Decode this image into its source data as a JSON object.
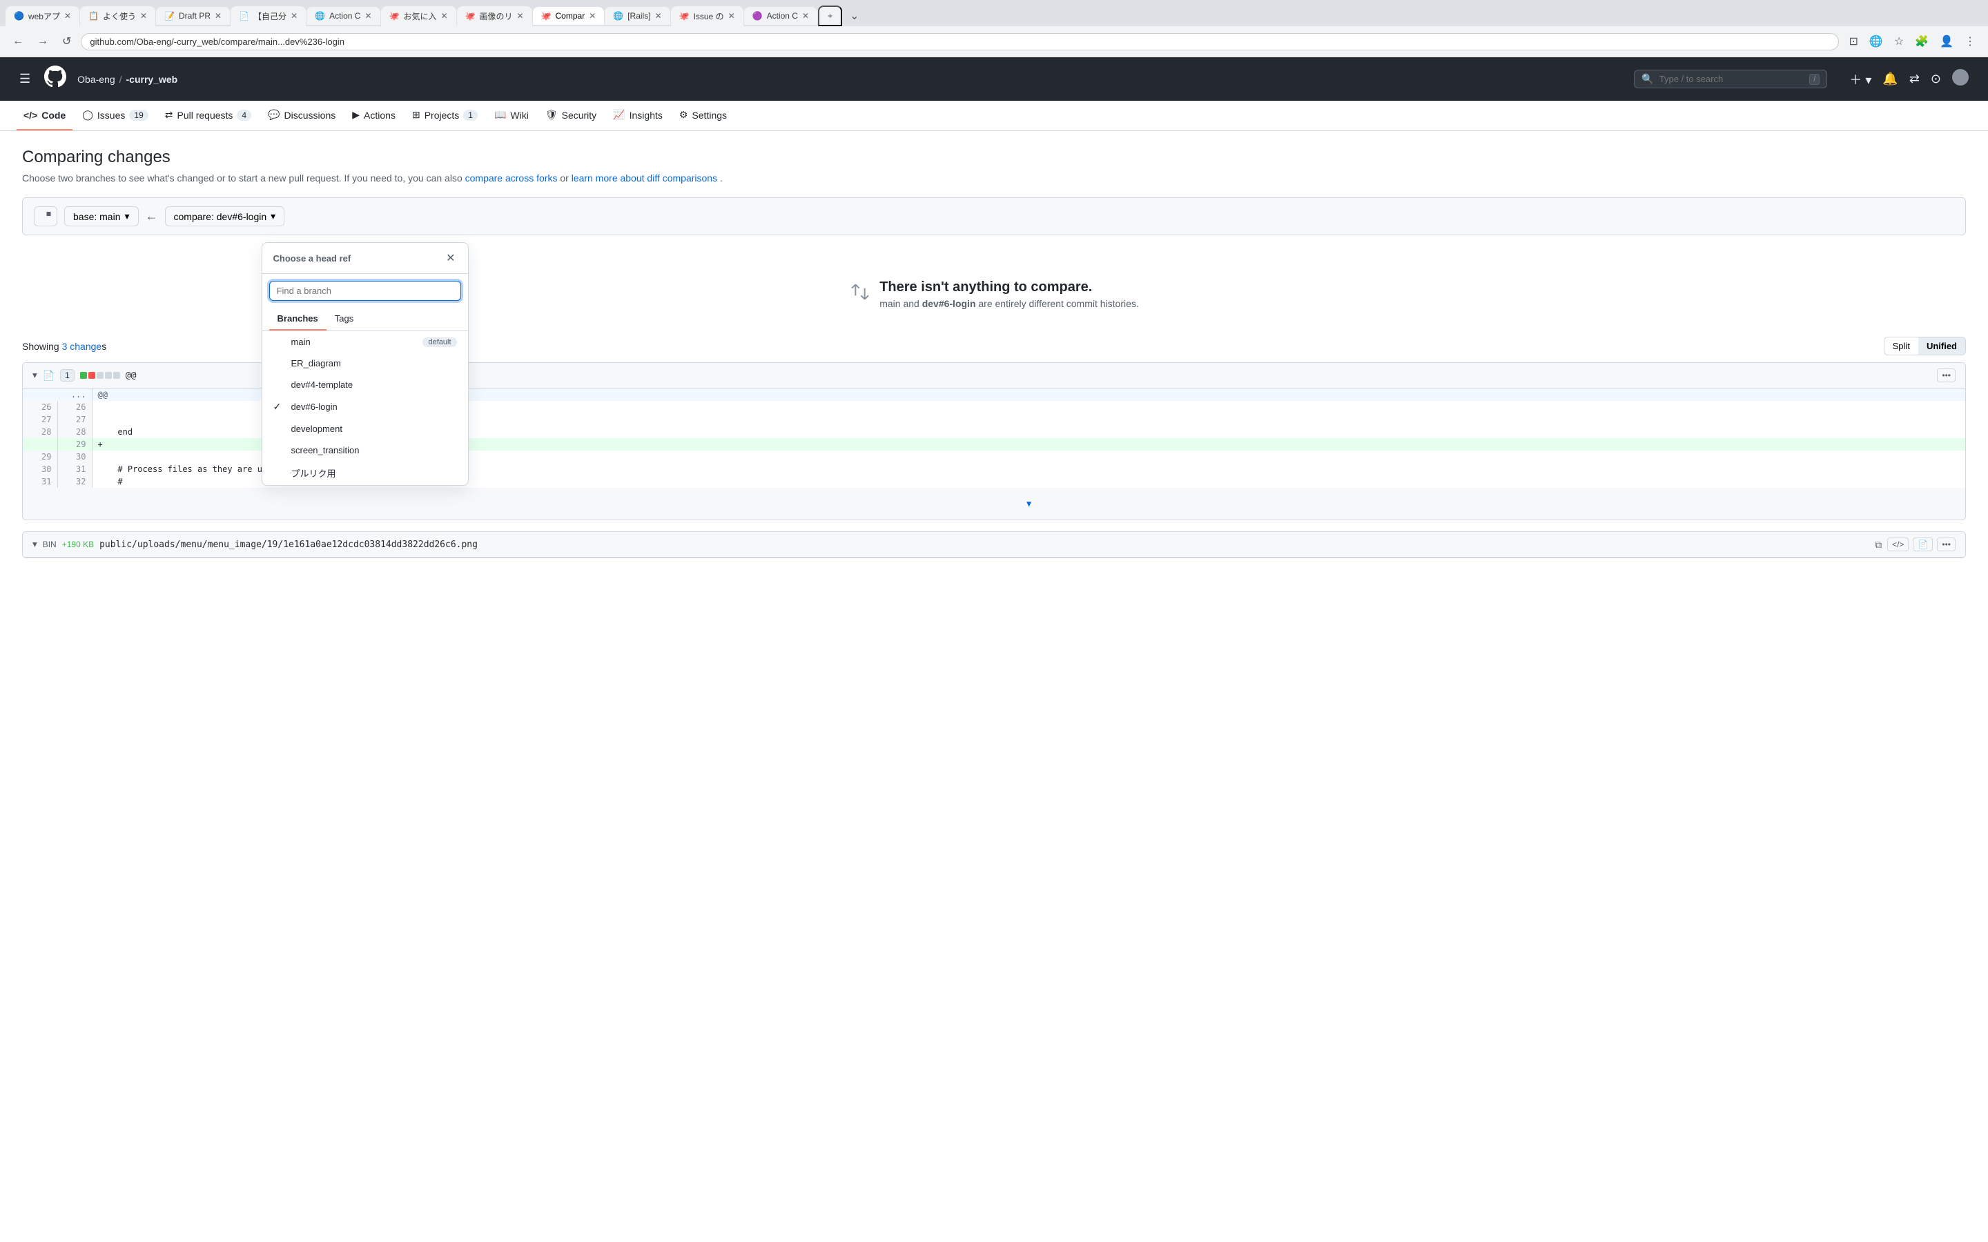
{
  "browser": {
    "url": "github.com/Oba-eng/-curry_web/compare/main...dev%236-login",
    "tabs": [
      {
        "id": "tab1",
        "label": "webアプ",
        "icon": "🔵",
        "active": false
      },
      {
        "id": "tab2",
        "label": "よく使う",
        "icon": "📋",
        "active": false
      },
      {
        "id": "tab3",
        "label": "Draft PR",
        "icon": "📝",
        "active": false
      },
      {
        "id": "tab4",
        "label": "【自己分",
        "icon": "📄",
        "active": false
      },
      {
        "id": "tab5",
        "label": "Action C",
        "icon": "🌐",
        "active": false
      },
      {
        "id": "tab6",
        "label": "お気に入",
        "icon": "🐙",
        "active": false
      },
      {
        "id": "tab7",
        "label": "画像のリ",
        "icon": "🐙",
        "active": false
      },
      {
        "id": "tab8",
        "label": "Compar",
        "icon": "🐙",
        "active": true
      },
      {
        "id": "tab9",
        "label": "[Rails]",
        "icon": "🌐",
        "active": false
      },
      {
        "id": "tab10",
        "label": "Issue の",
        "icon": "🐙",
        "active": false
      },
      {
        "id": "tab11",
        "label": "Action C",
        "icon": "🟣",
        "active": false
      }
    ]
  },
  "github_header": {
    "logo_alt": "GitHub",
    "org": "Oba-eng",
    "separator": "/",
    "repo": "-curry_web",
    "search_placeholder": "Type / to search",
    "search_slash_badge": "/"
  },
  "repo_nav": {
    "items": [
      {
        "id": "code",
        "label": "Code",
        "icon": "code",
        "badge": null,
        "active": true
      },
      {
        "id": "issues",
        "label": "Issues",
        "icon": "circle",
        "badge": "19",
        "active": false
      },
      {
        "id": "pull_requests",
        "label": "Pull requests",
        "icon": "pull",
        "badge": "4",
        "active": false
      },
      {
        "id": "discussions",
        "label": "Discussions",
        "icon": "chat",
        "badge": null,
        "active": false
      },
      {
        "id": "actions",
        "label": "Actions",
        "icon": "play",
        "badge": null,
        "active": false
      },
      {
        "id": "projects",
        "label": "Projects",
        "icon": "grid",
        "badge": "1",
        "active": false
      },
      {
        "id": "wiki",
        "label": "Wiki",
        "icon": "book",
        "badge": null,
        "active": false
      },
      {
        "id": "security",
        "label": "Security",
        "icon": "shield",
        "badge": null,
        "active": false
      },
      {
        "id": "insights",
        "label": "Insights",
        "icon": "graph",
        "badge": null,
        "active": false
      },
      {
        "id": "settings",
        "label": "Settings",
        "icon": "gear",
        "badge": null,
        "active": false
      }
    ]
  },
  "page": {
    "title": "Comparing changes",
    "description_start": "Choose two branches to see what's changed or to start a new pull request. If you need to, you can also ",
    "link1_text": "compare across forks",
    "link1_url": "#",
    "link_separator": " or ",
    "link2_text": "learn more about diff comparisons",
    "link2_url": "#",
    "description_end": "."
  },
  "compare": {
    "base_label": "base: main",
    "compare_label": "compare: dev#6-login",
    "dropdown_title": "Choose a head ref",
    "find_branch_placeholder": "Find a branch",
    "tabs": [
      {
        "id": "branches",
        "label": "Branches",
        "active": true
      },
      {
        "id": "tags",
        "label": "Tags",
        "active": false
      }
    ],
    "branches": [
      {
        "id": "main",
        "name": "main",
        "default": true,
        "selected": false
      },
      {
        "id": "er_diagram",
        "name": "ER_diagram",
        "default": false,
        "selected": false
      },
      {
        "id": "dev4_template",
        "name": "dev#4-template",
        "default": false,
        "selected": false
      },
      {
        "id": "dev6_login",
        "name": "dev#6-login",
        "default": false,
        "selected": true
      },
      {
        "id": "development",
        "name": "development",
        "default": false,
        "selected": false
      },
      {
        "id": "screen_transition",
        "name": "screen_transition",
        "default": false,
        "selected": false
      },
      {
        "id": "pullreq",
        "name": "プルリク用",
        "default": false,
        "selected": false
      }
    ],
    "default_badge": "default"
  },
  "no_compare": {
    "title": "There isn't anything to compare.",
    "description_prefix": "main and ",
    "branch_name": "dev#6-login",
    "description_suffix": " are entirely different commit histories."
  },
  "diff": {
    "showing_prefix": "Showing ",
    "showing_link": "3 change",
    "showing_suffix": "s",
    "view_split": "Split",
    "view_unified": "Unified",
    "files": [
      {
        "id": "file1",
        "count": 1,
        "stats": [
          1,
          1,
          3
        ],
        "filename": "@@",
        "lines": [
          {
            "old_num": "26",
            "new_num": "26",
            "type": "normal",
            "content": ""
          },
          {
            "old_num": "27",
            "new_num": "27",
            "type": "normal",
            "content": ""
          },
          {
            "old_num": "28",
            "new_num": "28",
            "type": "normal",
            "content": "    end"
          },
          {
            "old_num": "",
            "new_num": "29",
            "type": "added",
            "content": "    +"
          },
          {
            "old_num": "29",
            "new_num": "30",
            "type": "normal",
            "content": ""
          },
          {
            "old_num": "30",
            "new_num": "31",
            "type": "normal",
            "content": "    # Process files as they are uploaded:"
          },
          {
            "old_num": "31",
            "new_num": "32",
            "type": "normal",
            "content": "    #"
          }
        ]
      },
      {
        "id": "file2",
        "filename": "BIN  +190 KB  public/uploads/menu/menu_image/19/1e161a0ae12dcdc03814dd3822dd26c6.png",
        "is_binary": true
      }
    ]
  }
}
